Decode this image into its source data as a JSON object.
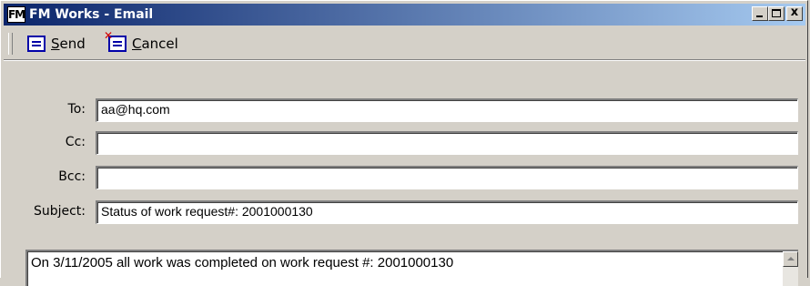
{
  "window": {
    "title": "FM Works - Email",
    "icon_text": "FM",
    "controls": {
      "minimize_icon": "minimize-icon",
      "maximize_icon": "maximize-icon",
      "close_glyph": "x"
    }
  },
  "toolbar": {
    "send": {
      "accel": "S",
      "rest": "end",
      "icon": "send-icon"
    },
    "cancel": {
      "accel": "C",
      "rest": "ancel",
      "icon": "cancel-icon"
    }
  },
  "form": {
    "to": {
      "label": "To:",
      "value": "aa@hq.com"
    },
    "cc": {
      "label": "Cc:",
      "value": ""
    },
    "bcc": {
      "label": "Bcc:",
      "value": ""
    },
    "subject": {
      "label": "Subject:",
      "value": "Status of work request#: 2001000130"
    }
  },
  "body": {
    "text": "On 3/11/2005 all work was completed on work request #: 2001000130"
  },
  "colors": {
    "titlebar_start": "#0a246a",
    "titlebar_end": "#a6caf0",
    "face": "#d4d0c8",
    "cancel_x": "#d40000"
  }
}
